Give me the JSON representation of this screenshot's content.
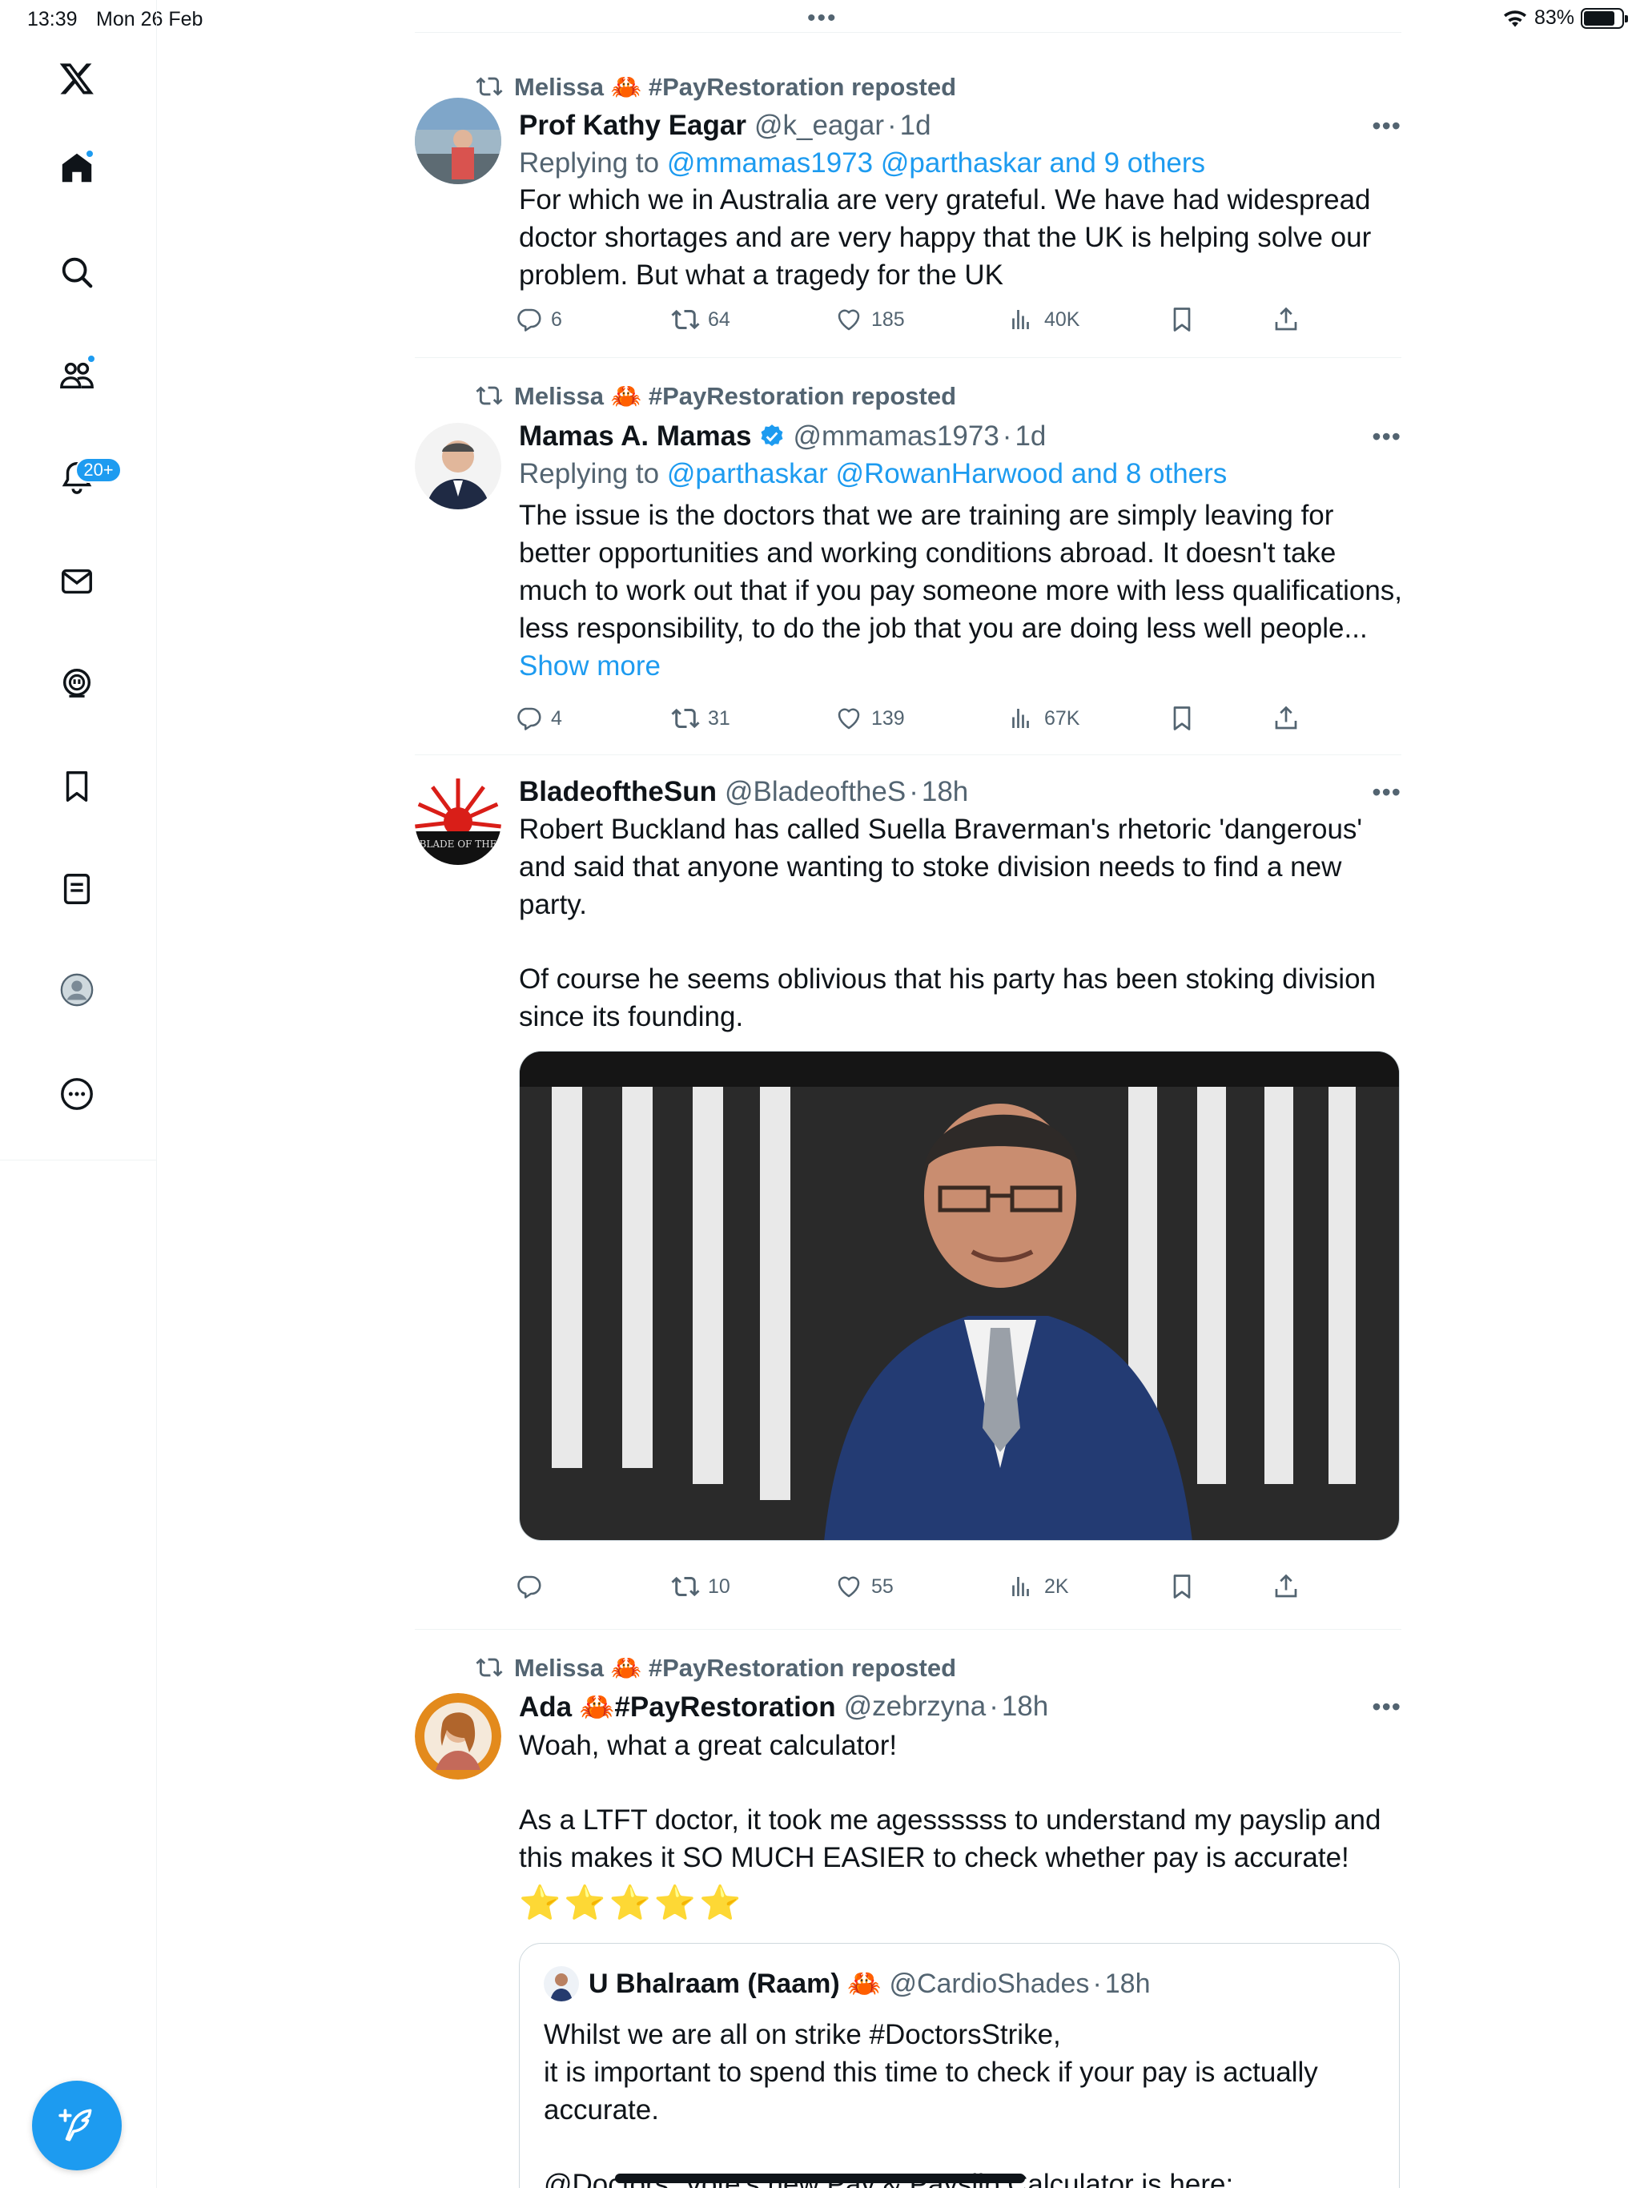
{
  "status_bar": {
    "time": "13:39",
    "date": "Mon 26 Feb",
    "battery_text": "83%",
    "battery_level": 0.83
  },
  "sidebar": {
    "items": [
      {
        "name": "logo",
        "icon": "x-logo-icon"
      },
      {
        "name": "home",
        "icon": "home-icon"
      },
      {
        "name": "explore",
        "icon": "search-icon"
      },
      {
        "name": "communities",
        "icon": "communities-icon"
      },
      {
        "name": "notifications",
        "icon": "bell-icon"
      },
      {
        "name": "messages",
        "icon": "mail-icon"
      },
      {
        "name": "grok",
        "icon": "grok-icon"
      },
      {
        "name": "bookmarks",
        "icon": "bookmark-icon"
      },
      {
        "name": "lists",
        "icon": "list-icon"
      },
      {
        "name": "profile",
        "icon": "profile-icon"
      },
      {
        "name": "more",
        "icon": "more-circle-icon"
      }
    ],
    "notifications_badge": "20+"
  },
  "tweets": [
    {
      "social": "Melissa 🦀 #PayRestoration reposted",
      "name": "Prof Kathy Eagar",
      "handle": "@k_eagar",
      "time": "1d",
      "replying_prefix": "Replying to ",
      "replying_links": "@mmamas1973 @parthaskar and 9 others",
      "text": "For which we in Australia are very grateful. We have had widespread doctor shortages and are very happy that the UK is helping solve our problem. But what a tragedy for the UK",
      "replies": "6",
      "reposts": "64",
      "likes": "185",
      "views": "40K"
    },
    {
      "social": "Melissa 🦀 #PayRestoration reposted",
      "name": "Mamas A. Mamas",
      "handle": "@mmamas1973",
      "time": "1d",
      "replying_prefix": "Replying to ",
      "replying_links": "@parthaskar @RowanHarwood and 8 others",
      "text": "The issue is the doctors that we are training are simply leaving for better opportunities and working conditions abroad. It doesn't take much to work out that if you pay someone more with less qualifications, less responsibility, to do the job that you are doing less well people...",
      "show_more": "Show more",
      "replies": "4",
      "reposts": "31",
      "likes": "139",
      "views": "67K"
    },
    {
      "name": "BladeoftheSun",
      "handle": "@BladeoftheS",
      "time": "18h",
      "avatar_text": "BLADE OF THE",
      "text_p1": "Robert Buckland has called Suella Braverman's rhetoric 'dangerous' and said that anyone wanting to stoke division needs to find a new party.",
      "text_p2": "Of course he seems oblivious that his party has been stoking division since its founding.",
      "replies": "",
      "reposts": "10",
      "likes": "55",
      "views": "2K"
    },
    {
      "social": "Melissa 🦀 #PayRestoration reposted",
      "name": "Ada 🦀#PayRestoration",
      "handle": "@zebrzyna",
      "time": "18h",
      "text_p1": "Woah, what a great calculator!",
      "text_p2": "As a LTFT doctor, it took me agessssss to understand my payslip and this makes it SO MUCH EASIER to check whether pay is accurate!",
      "stars": "⭐⭐⭐⭐⭐",
      "quote": {
        "name": "U Bhalraam (Raam) 🦀",
        "handle": "@CardioShades",
        "time": "18h",
        "text_p1": "Whilst we are all on strike #DoctorsStrike,\nit is important to spend this time to check if your pay is actually accurate.",
        "text_p2": "@Doctors_Vote's new Pay & Payslip Calculator is here:..."
      }
    }
  ],
  "colors": {
    "accent": "#1d9bf0",
    "text": "#0f1419",
    "muted": "#536471",
    "border": "#eff3f4"
  }
}
